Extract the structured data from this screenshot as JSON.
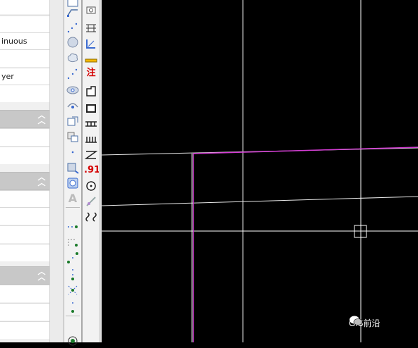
{
  "properties_panel": {
    "linetype_value": "inuous",
    "layer_value": "yer"
  },
  "toolbar_right": {
    "annotate_label": "注",
    "decimal_label": ".91"
  },
  "toolbar_left": {
    "text_tool_label": "A"
  },
  "watermark": {
    "text": "GIS前沿"
  }
}
